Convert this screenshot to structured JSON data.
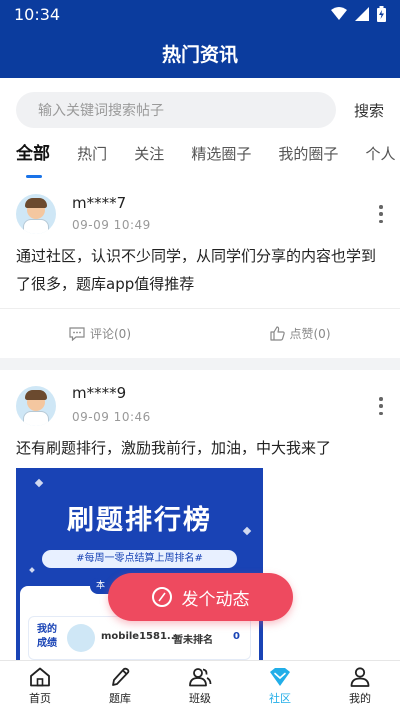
{
  "status_bar": {
    "time": "10:34"
  },
  "header": {
    "title": "热门资讯"
  },
  "search": {
    "placeholder": "输入关键词搜索帖子",
    "button_label": "搜索"
  },
  "tabs": [
    {
      "label": "全部",
      "active": true
    },
    {
      "label": "热门"
    },
    {
      "label": "关注"
    },
    {
      "label": "精选圈子"
    },
    {
      "label": "我的圈子"
    },
    {
      "label": "个人"
    }
  ],
  "posts": [
    {
      "username": "m****7",
      "time": "09-09 10:49",
      "content": "通过社区，认识不少同学，从同学们分享的内容也学到了很多，题库app值得推荐",
      "comment_label": "评论(0)",
      "like_label": "点赞(0)"
    },
    {
      "username": "m****9",
      "time": "09-09 10:46",
      "content": "还有刷题排行，激励我前行，加油，中大我来了",
      "image": {
        "title": "刷题排行榜",
        "subtitle": "#每周一零点结算上周排名#",
        "card_tab": "本",
        "my_score_label": "我的成绩",
        "name": "mobile1581...",
        "rank": "暂未排名",
        "score": "0"
      }
    }
  ],
  "fab": {
    "label": "发个动态"
  },
  "bottom_nav": [
    {
      "label": "首页",
      "icon": "home-icon"
    },
    {
      "label": "题库",
      "icon": "pencil-icon"
    },
    {
      "label": "班级",
      "icon": "group-icon"
    },
    {
      "label": "社区",
      "icon": "community-icon",
      "active": true
    },
    {
      "label": "我的",
      "icon": "profile-icon"
    }
  ],
  "colors": {
    "header_blue": "#0b3c9e",
    "accent_blue": "#1a73e8",
    "fab_red": "#ee4a5f",
    "nav_active": "#22aee8"
  }
}
